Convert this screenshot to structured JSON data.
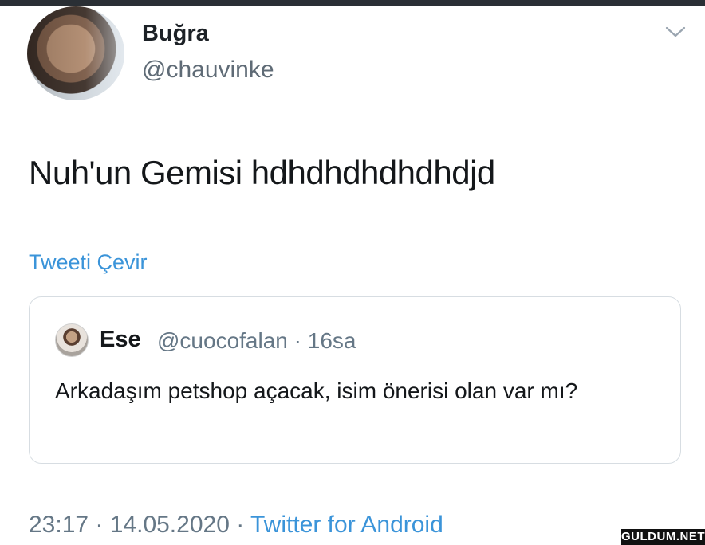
{
  "author": {
    "name": "Buğra",
    "handle": "@chauvinke"
  },
  "tweet": {
    "text": "Nuh'un Gemisi hdhdhdhdhdhdjd",
    "translate_label": "Tweeti Çevir"
  },
  "quoted_tweet": {
    "name": "Ese",
    "handle_time": "@cuocofalan · 16sa",
    "text": "Arkadaşım petshop açacak, isim önerisi olan var mı?"
  },
  "meta": {
    "time_date": "23:17 · 14.05.2020 · ",
    "source": "Twitter for Android"
  },
  "watermark": "GULDUM.NET",
  "icons": {
    "menu": "chevron-down-icon"
  },
  "colors": {
    "link": "#3b94d9",
    "secondary_text": "#657786",
    "primary_text": "#14171a"
  }
}
